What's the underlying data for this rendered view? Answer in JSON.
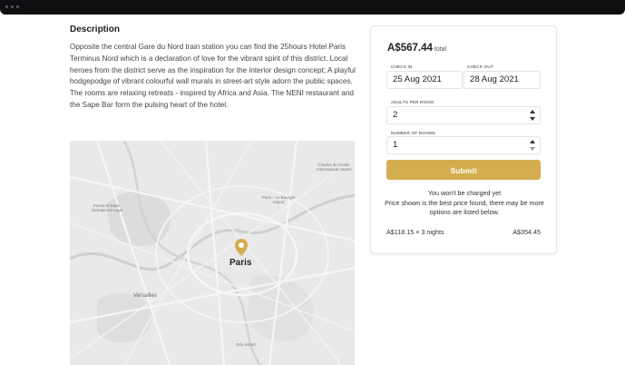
{
  "description": {
    "heading": "Description",
    "body": "Opposite the central Gare du Nord train station you can find the 25hours Hotel Paris Terminus Nord which is a declaration of love for the vibrant spirit of this district. Local heroes from the district serve as the inspiration for the interior design concept; A playful hodgepodge of vibrant colourful wall murals in street-art style adorn the public spaces. The rooms are relaxing retreats - inspired by Africa and Asia. The NENI restaurant and the Sape Bar form the pulsing heart of the hotel."
  },
  "map": {
    "city_label": "Paris",
    "labels": {
      "cdg": "Charles de Gaulle International Airport",
      "bourget": "Paris – Le Bourget Airport",
      "saint_germain": "Forest of Saint-Germain-en-Laye",
      "versailles": "Versailles",
      "orly": "Orly Airport"
    },
    "pin_color": "#d4ad4f"
  },
  "booking": {
    "price": "A$567.44",
    "price_suffix": "total",
    "check_in_label": "CHECK IN",
    "check_in_value": "25 Aug 2021",
    "check_out_label": "CHECK OUT",
    "check_out_value": "28 Aug 2021",
    "adults_label": "ADULTS PER ROOM",
    "adults_value": "2",
    "rooms_label": "NUMBER OF ROOMS",
    "rooms_value": "1",
    "submit_label": "Submit",
    "note_line1": "You won't be charged yet",
    "note_line2": "Price shown is the best price found, there may be more options are listed below.",
    "calc_left": "A$118.15 × 3 nights",
    "calc_right": "A$354.45",
    "accent_color": "#d4ad4f"
  }
}
